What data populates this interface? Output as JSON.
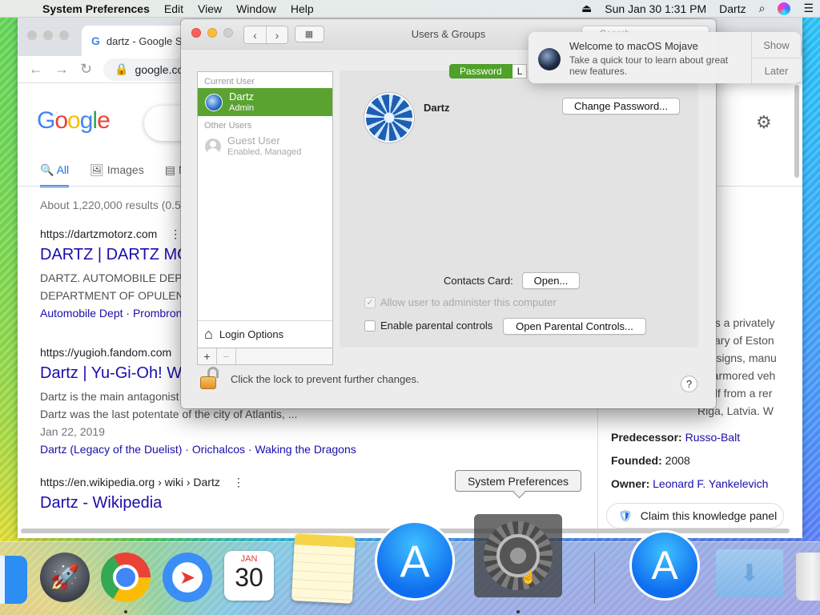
{
  "menubar": {
    "app_name": "System Preferences",
    "menus": [
      "Edit",
      "View",
      "Window",
      "Help"
    ],
    "datetime": "Sun Jan 30  1:31 PM",
    "user": "Dartz"
  },
  "browser": {
    "tab_title": "dartz - Google S",
    "url": "google.co",
    "google_logo": "Google",
    "result_tabs": [
      "All",
      "Images"
    ],
    "stats": "About 1,220,000 results (0.5",
    "results": [
      {
        "url": "https://dartzmotorz.com",
        "title": "DARTZ | DARTZ MO",
        "snippet_1": "DARTZ. AUTOMOBILE DEP",
        "snippet_2": "DEPARTMENT OF OPULEN",
        "links": "Automobile Dept · Prombron"
      },
      {
        "url": "https://yugioh.fandom.com",
        "title": "Dartz | Yu-Gi-Oh! W",
        "snippet_1": "Dartz is the main antagonist",
        "snippet_2": "Dartz was the last potentate of the city of Atlantis, ...",
        "date": "Jan 22, 2019",
        "links": "Dartz (Legacy of the Duelist) · Orichalcos · Waking the Dragons"
      },
      {
        "url": "https://en.wikipedia.org › wiki › Dartz",
        "title": "Dartz - Wikipedia"
      }
    ],
    "knowledge_panel": {
      "snippet_lines": [
        "ny is a privately",
        "sidiary of Eston",
        "t designs, manu",
        "ce armored veh",
        "itself from a rer",
        "Riga, Latvia. W"
      ],
      "facts": [
        {
          "label": "Predecessor:",
          "value": "Russo-Balt"
        },
        {
          "label": "Founded:",
          "value": "2008"
        },
        {
          "label": "Owner:",
          "value": "Leonard F. Yankelevich"
        }
      ],
      "claim_label": "Claim this knowledge panel"
    }
  },
  "prefs": {
    "title": "Users & Groups",
    "search_placeholder": "Search",
    "current_user_header": "Current User",
    "other_users_header": "Other Users",
    "users": [
      {
        "name": "Dartz",
        "role": "Admin"
      },
      {
        "name": "Guest User",
        "role": "Enabled, Managed"
      }
    ],
    "login_options": "Login Options",
    "add_label": "+",
    "remove_label": "−",
    "tab_password": "Password",
    "tab_login": "L",
    "user_name": "Dartz",
    "change_password": "Change Password...",
    "contacts_label": "Contacts Card:",
    "open_label": "Open...",
    "allow_admin": "Allow user to administer this computer",
    "enable_parental": "Enable parental controls",
    "open_parental": "Open Parental Controls...",
    "lock_text": "Click the lock to prevent further changes.",
    "help": "?"
  },
  "notification": {
    "title": "Welcome to macOS Mojave",
    "body": "Take a quick tour to learn about great new features.",
    "show": "Show",
    "later": "Later"
  },
  "tooltip": "System Preferences",
  "dock": {
    "calendar_month": "JAN",
    "calendar_day": "30"
  }
}
